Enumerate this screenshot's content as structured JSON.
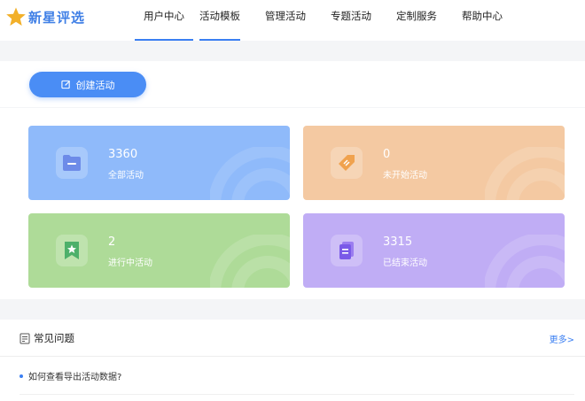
{
  "logo": {
    "text": "新星评选"
  },
  "nav": [
    {
      "label": "用户中心",
      "active": true
    },
    {
      "label": "活动模板",
      "active": true
    },
    {
      "label": "管理活动",
      "active": false
    },
    {
      "label": "专题活动",
      "active": false
    },
    {
      "label": "定制服务",
      "active": false
    },
    {
      "label": "帮助中心",
      "active": false
    }
  ],
  "create_button": {
    "label": "创建活动"
  },
  "stats": [
    {
      "value": "3360",
      "label": "全部活动",
      "color": "#8fbafa",
      "icon": "folder-icon"
    },
    {
      "value": "0",
      "label": "未开始活动",
      "color": "#f4c9a2",
      "icon": "tag-icon"
    },
    {
      "value": "2",
      "label": "进行中活动",
      "color": "#aedb98",
      "icon": "star-bookmark-icon"
    },
    {
      "value": "3315",
      "label": "已结束活动",
      "color": "#c0adf5",
      "icon": "document-icon"
    }
  ],
  "faq": {
    "title": "常见问题",
    "more": "更多>",
    "items": [
      "如何查看导出活动数据?"
    ]
  },
  "colors": {
    "accent": "#3b7ff2",
    "brand": "#3f7fe6"
  }
}
